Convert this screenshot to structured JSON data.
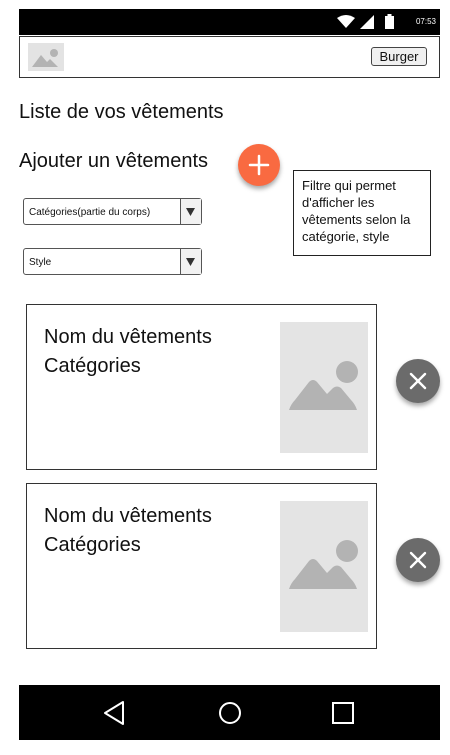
{
  "status_bar": {
    "time": "07:53",
    "icons": [
      "wifi-icon",
      "signal-icon",
      "battery-icon"
    ]
  },
  "app_bar": {
    "logo_icon": "image-placeholder-icon",
    "burger_label": "Burger"
  },
  "main": {
    "title": "Liste de vos vêtements",
    "add_label": "Ajouter un vêtements",
    "add_button_icon": "plus-icon",
    "filter_note": "Filtre qui permet d'afficher les vêtements selon la catégorie, style",
    "filters": {
      "category_value": "Catégories(partie du corps)",
      "style_value": "Style"
    },
    "items": [
      {
        "name": "Nom du vêtements",
        "category": "Catégories",
        "image_icon": "image-placeholder-icon",
        "delete_icon": "close-icon"
      },
      {
        "name": "Nom du vêtements",
        "category": "Catégories",
        "image_icon": "image-placeholder-icon",
        "delete_icon": "close-icon"
      }
    ]
  },
  "nav_bar": {
    "icons": [
      "back-icon",
      "home-icon",
      "recent-apps-icon"
    ]
  },
  "colors": {
    "fab_accent": "#f96a41",
    "delete_button": "#6b6b6b",
    "bars": "#000000",
    "placeholder": "#e4e4e4"
  }
}
